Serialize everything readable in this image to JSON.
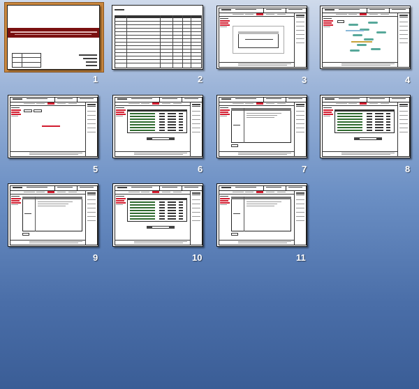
{
  "app": "Slide Sorter",
  "slides": [
    {
      "number": "1",
      "selected": true,
      "kind": "title"
    },
    {
      "number": "2",
      "selected": false,
      "kind": "table"
    },
    {
      "number": "3",
      "selected": false,
      "kind": "form-dialog"
    },
    {
      "number": "4",
      "selected": false,
      "kind": "diagram"
    },
    {
      "number": "5",
      "selected": false,
      "kind": "form-text"
    },
    {
      "number": "6",
      "selected": false,
      "kind": "form-list"
    },
    {
      "number": "7",
      "selected": false,
      "kind": "form-detail"
    },
    {
      "number": "8",
      "selected": false,
      "kind": "form-list"
    },
    {
      "number": "9",
      "selected": false,
      "kind": "form-detail"
    },
    {
      "number": "10",
      "selected": false,
      "kind": "form-list"
    },
    {
      "number": "11",
      "selected": false,
      "kind": "form-detail"
    }
  ],
  "colors": {
    "background_top": "#cfdaeb",
    "background_bottom": "#3a5d96",
    "selection": "#c9873e",
    "title_band": "#7a1010",
    "accent_red": "#c4152b"
  }
}
